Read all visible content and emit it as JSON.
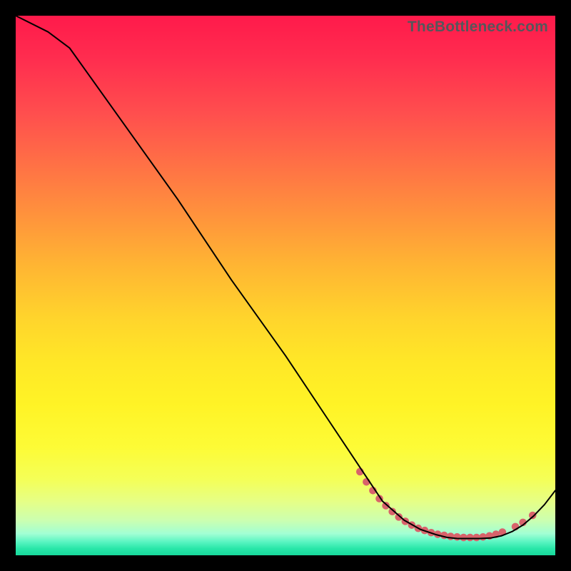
{
  "watermark": "TheBottleneck.com",
  "chart_data": {
    "type": "line",
    "title": "",
    "xlabel": "",
    "ylabel": "",
    "xlim": [
      0,
      100
    ],
    "ylim": [
      0,
      100
    ],
    "series": [
      {
        "name": "curve",
        "x": [
          0,
          6,
          10,
          20,
          30,
          40,
          50,
          58,
          64,
          68,
          72,
          75,
          78,
          80,
          82,
          84,
          86,
          88,
          90,
          92,
          94,
          96,
          98,
          100
        ],
        "y": [
          100,
          97,
          94,
          80,
          66,
          51,
          37,
          25,
          16,
          10,
          6.5,
          4.8,
          3.8,
          3.3,
          3.1,
          3.1,
          3.1,
          3.2,
          3.6,
          4.4,
          5.6,
          7.3,
          9.4,
          12
        ],
        "color": "#000000",
        "stroke_width": 2
      }
    ],
    "markers": {
      "name": "flat-markers",
      "x": [
        63.8,
        65.0,
        66.2,
        67.4,
        68.6,
        69.8,
        71.0,
        72.2,
        73.4,
        74.6,
        75.8,
        77.0,
        78.2,
        79.4,
        80.6,
        81.8,
        83.0,
        84.2,
        85.4,
        86.6,
        87.8,
        89.0,
        90.2,
        92.6,
        94.0,
        95.8
      ],
      "y": [
        15.5,
        13.6,
        12.0,
        10.5,
        9.2,
        8.1,
        7.1,
        6.3,
        5.6,
        5.0,
        4.6,
        4.2,
        3.9,
        3.7,
        3.5,
        3.4,
        3.3,
        3.3,
        3.3,
        3.4,
        3.6,
        3.9,
        4.3,
        5.3,
        6.1,
        7.4
      ],
      "color": "#d8636b",
      "size": 5.3
    }
  }
}
